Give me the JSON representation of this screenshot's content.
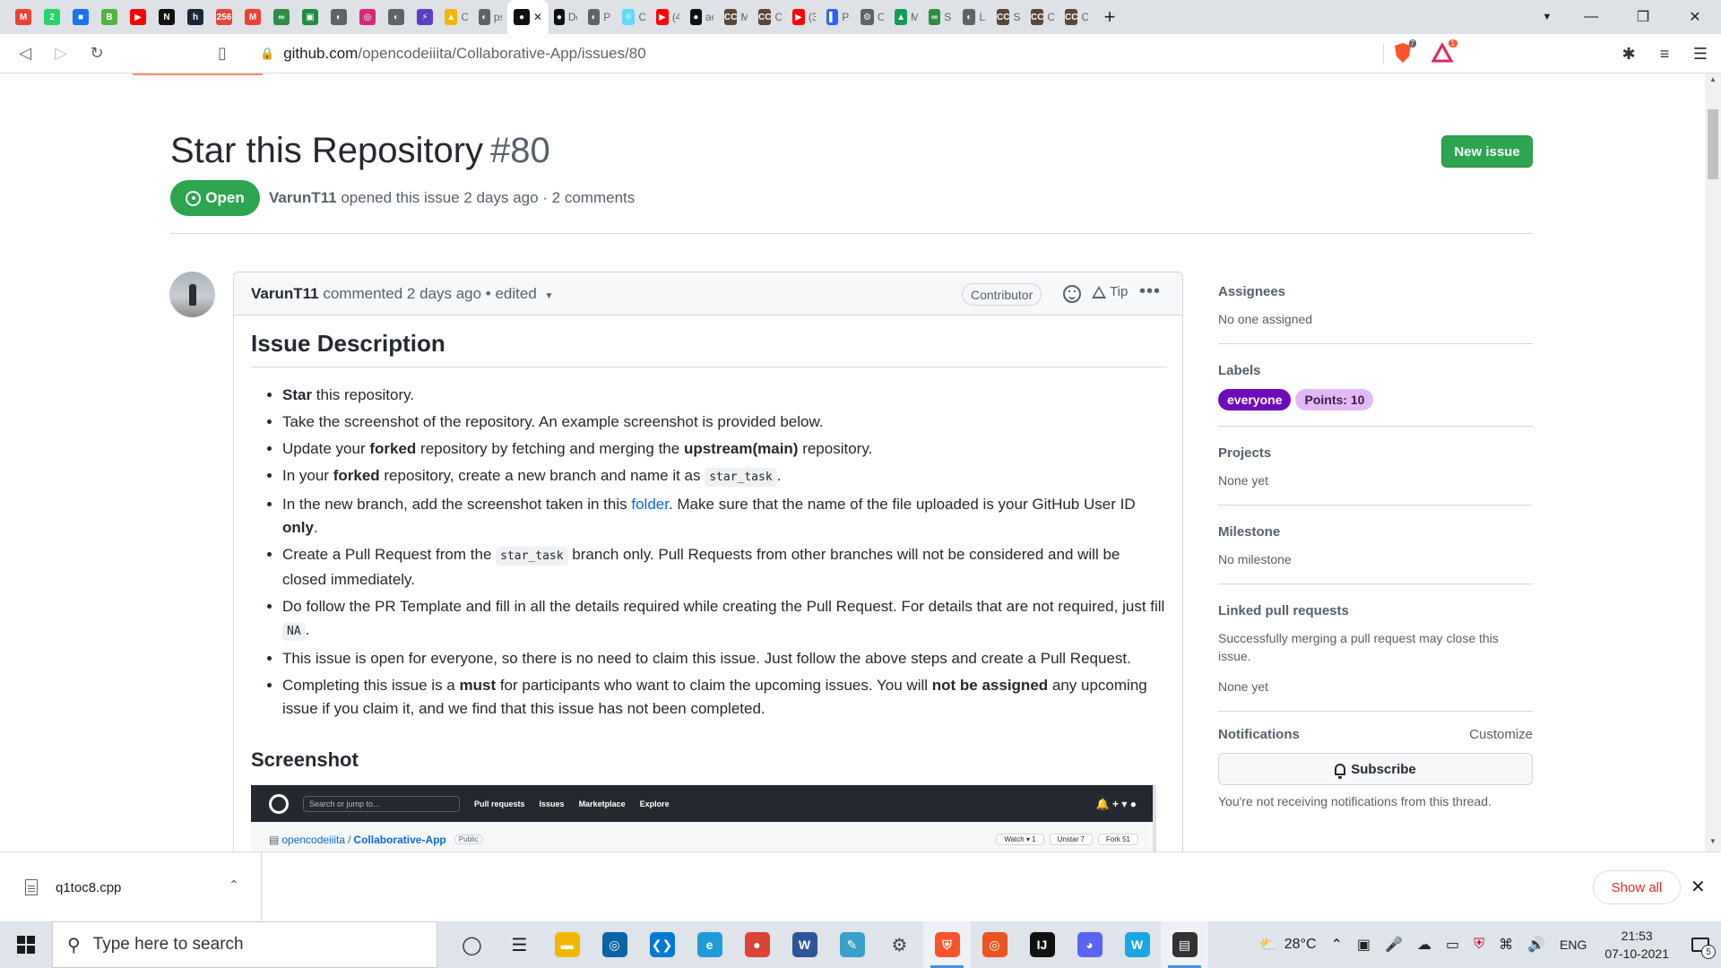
{
  "browser": {
    "tabs": [
      {
        "icon": "gmail-icon",
        "color": "#ea4335",
        "glyph": "M",
        "title": ""
      },
      {
        "icon": "whatsapp-icon",
        "color": "#25d366",
        "glyph": "2",
        "title": ""
      },
      {
        "icon": "contacts-icon",
        "color": "#1a73e8",
        "glyph": "■",
        "title": ""
      },
      {
        "icon": "brainly-icon",
        "color": "#53b53f",
        "glyph": "B",
        "title": ""
      },
      {
        "icon": "youtube-icon",
        "color": "#ff0000",
        "glyph": "▶",
        "title": ""
      },
      {
        "icon": "nptel-icon",
        "color": "#111111",
        "glyph": "N",
        "title": ""
      },
      {
        "icon": "hackerrank-icon",
        "color": "#1a2638",
        "glyph": "h",
        "title": ""
      },
      {
        "icon": "notion-badge-icon",
        "color": "#e04a39",
        "glyph": "256",
        "title": ""
      },
      {
        "icon": "gmail-icon",
        "color": "#ea4335",
        "glyph": "M",
        "title": ""
      },
      {
        "icon": "geeksforgeeks-icon",
        "color": "#2f8d46",
        "glyph": "∞",
        "title": ""
      },
      {
        "icon": "classroom-icon",
        "color": "#1e8e3e",
        "glyph": "▣",
        "title": ""
      },
      {
        "icon": "globe-icon",
        "color": "#5f6368",
        "glyph": "◐",
        "title": ""
      },
      {
        "icon": "instagram-icon",
        "color": "#d62976",
        "glyph": "◎",
        "title": ""
      },
      {
        "icon": "globe-icon",
        "color": "#5f6368",
        "glyph": "◐",
        "title": ""
      },
      {
        "icon": "bolt-icon",
        "color": "#5b3fc8",
        "glyph": "⚡",
        "title": ""
      },
      {
        "icon": "drive-icon",
        "color": "#f4b400",
        "glyph": "▲",
        "title": "O"
      },
      {
        "icon": "globe-icon",
        "color": "#5f6368",
        "glyph": "◐",
        "title": "ps"
      },
      {
        "icon": "github-icon",
        "color": "#111111",
        "glyph": "●",
        "title": "",
        "active": true
      },
      {
        "icon": "github-icon",
        "color": "#111111",
        "glyph": "●",
        "title": "De"
      },
      {
        "icon": "globe-icon",
        "color": "#5f6368",
        "glyph": "◐",
        "title": "Pr"
      },
      {
        "icon": "react-icon",
        "color": "#61dafb",
        "glyph": "⚛",
        "title": "O"
      },
      {
        "icon": "youtube-icon",
        "color": "#ff0000",
        "glyph": "▶",
        "title": "(4"
      },
      {
        "icon": "github-icon",
        "color": "#111111",
        "glyph": "●",
        "title": "ac"
      },
      {
        "icon": "codechef-icon",
        "color": "#5b4638",
        "glyph": "CC",
        "title": "M"
      },
      {
        "icon": "codechef-icon",
        "color": "#5b4638",
        "glyph": "CC",
        "title": "Co"
      },
      {
        "icon": "youtube-icon",
        "color": "#ff0000",
        "glyph": "▶",
        "title": "(3"
      },
      {
        "icon": "chart-icon",
        "color": "#2962ff",
        "glyph": "▌",
        "title": "Pr"
      },
      {
        "icon": "robot-icon",
        "color": "#5f6368",
        "glyph": "⚙",
        "title": "C"
      },
      {
        "icon": "drive-icon",
        "color": "#0f9d58",
        "glyph": "▲",
        "title": "M"
      },
      {
        "icon": "geeksforgeeks-icon",
        "color": "#2f8d46",
        "glyph": "∞",
        "title": "Sr"
      },
      {
        "icon": "globe-icon",
        "color": "#5f6368",
        "glyph": "◐",
        "title": "Li"
      },
      {
        "icon": "codechef-icon",
        "color": "#5b4638",
        "glyph": "CC",
        "title": "Sc"
      },
      {
        "icon": "codechef-icon",
        "color": "#5b4638",
        "glyph": "CC",
        "title": "Co"
      },
      {
        "icon": "codechef-icon",
        "color": "#5b4638",
        "glyph": "CC",
        "title": "Co"
      }
    ],
    "new_tab_label": "+",
    "url_host": "github.com",
    "url_path": "/opencodeiiita/Collaborative-App/issues/80",
    "brave_shield_count": "7",
    "brave_rewards_count": "1"
  },
  "issue": {
    "title": "Star this Repository",
    "number": "#80",
    "new_issue_label": "New issue",
    "status": "Open",
    "author": "VarunT11",
    "meta_text": "opened this issue 2 days ago · 2 comments"
  },
  "comment": {
    "author": "VarunT11",
    "header_text": "commented 2 days ago • edited",
    "role_badge": "Contributor",
    "tip_label": "Tip",
    "heading": "Issue Description",
    "screenshot_heading": "Screenshot",
    "items": {
      "i1_b": "Star",
      "i1_t": " this repository.",
      "i2_t": "Take the screenshot of the repository. An example screenshot is provided below.",
      "i3_a": "Update your ",
      "i3_b1": "forked",
      "i3_c": " repository by fetching and merging the ",
      "i3_b2": "upstream(main)",
      "i3_d": " repository.",
      "i4_a": "In your ",
      "i4_b": "forked",
      "i4_c": " repository, create a new branch and name it as ",
      "i4_code": "star_task",
      "i4_d": ".",
      "i5_a": "In the new branch, add the screenshot taken in this ",
      "i5_link": "folder",
      "i5_c": ". Make sure that the name of the file uploaded is your GitHub User ID ",
      "i5_b": "only",
      "i5_d": ".",
      "i6_a": "Create a Pull Request from the ",
      "i6_code": "star_task",
      "i6_c": " branch only. Pull Requests from other branches will not be considered and will be closed immediately.",
      "i7_a": "Do follow the PR Template and fill in all the details required while creating the Pull Request. For details that are not required, just fill ",
      "i7_code": "NA",
      "i7_c": ".",
      "i8_t": "This issue is open for everyone, so there is no need to claim this issue. Just follow the above steps and create a Pull Request.",
      "i9_a": "Completing this issue is a ",
      "i9_b1": "must",
      "i9_c": " for participants who want to claim the upcoming issues. You will ",
      "i9_b2": "not be assigned",
      "i9_d": " any upcoming issue if you claim it, and we find that this issue has not been completed."
    },
    "embedded": {
      "search_placeholder": "Search or jump to...",
      "nav": [
        "Pull requests",
        "Issues",
        "Marketplace",
        "Explore"
      ],
      "repo_owner": "opencodeiiita",
      "repo_name": "Collaborative-App",
      "visibility": "Public",
      "watch": "Watch ▾  1",
      "unstar": "Unstar  7",
      "fork": "Fork  51"
    }
  },
  "sidebar": {
    "assignees_head": "Assignees",
    "assignees_val": "No one assigned",
    "labels_head": "Labels",
    "labels": [
      {
        "text": "everyone",
        "bg": "#6f0ab8",
        "fg": "#ffffff"
      },
      {
        "text": "Points: 10",
        "bg": "#e4b8f5",
        "fg": "#3a1d4d"
      }
    ],
    "projects_head": "Projects",
    "projects_val": "None yet",
    "milestone_head": "Milestone",
    "milestone_val": "No milestone",
    "linked_head": "Linked pull requests",
    "linked_desc": "Successfully merging a pull request may close this issue.",
    "linked_val": "None yet",
    "notif_head": "Notifications",
    "customize": "Customize",
    "subscribe": "Subscribe",
    "notif_msg": "You're not receiving notifications from this thread."
  },
  "downloads": {
    "file": "q1toc8.cpp",
    "show_all": "Show all"
  },
  "taskbar": {
    "search_placeholder": "Type here to search",
    "apps": [
      {
        "icon": "task-view-icon",
        "color": "#222222",
        "glyph": "◯"
      },
      {
        "icon": "timeline-icon",
        "color": "#222222",
        "glyph": "☰"
      },
      {
        "icon": "file-explorer-icon",
        "color": "#f2b705",
        "glyph": "▬"
      },
      {
        "icon": "dell-icon",
        "color": "#0a64a4",
        "glyph": "◎"
      },
      {
        "icon": "vscode-icon",
        "color": "#0078d4",
        "glyph": "❮❯"
      },
      {
        "icon": "edge-icon",
        "color": "#1f9bd8",
        "glyph": "e"
      },
      {
        "icon": "chrome-icon",
        "color": "#db4437",
        "glyph": "●"
      },
      {
        "icon": "word-icon",
        "color": "#2b579a",
        "glyph": "W"
      },
      {
        "icon": "notepad-icon",
        "color": "#3aa0c9",
        "glyph": "✎"
      },
      {
        "icon": "settings-icon",
        "color": "#444444",
        "glyph": "⚙"
      },
      {
        "icon": "brave-icon",
        "color": "#fb542b",
        "glyph": "⛨",
        "active": true
      },
      {
        "icon": "ubuntu-icon",
        "color": "#e95420",
        "glyph": "◎"
      },
      {
        "icon": "intellij-icon",
        "color": "#111111",
        "glyph": "IJ"
      },
      {
        "icon": "discord-icon",
        "color": "#5865f2",
        "glyph": "◕"
      },
      {
        "icon": "whatsapp-desktop-icon",
        "color": "#1aa5e3",
        "glyph": "W"
      },
      {
        "icon": "film-icon",
        "color": "#333333",
        "glyph": "▤",
        "active": true
      }
    ],
    "weather": "28°C",
    "lang": "ENG",
    "time": "21:53",
    "date": "07-10-2021",
    "notif_count": "5"
  }
}
